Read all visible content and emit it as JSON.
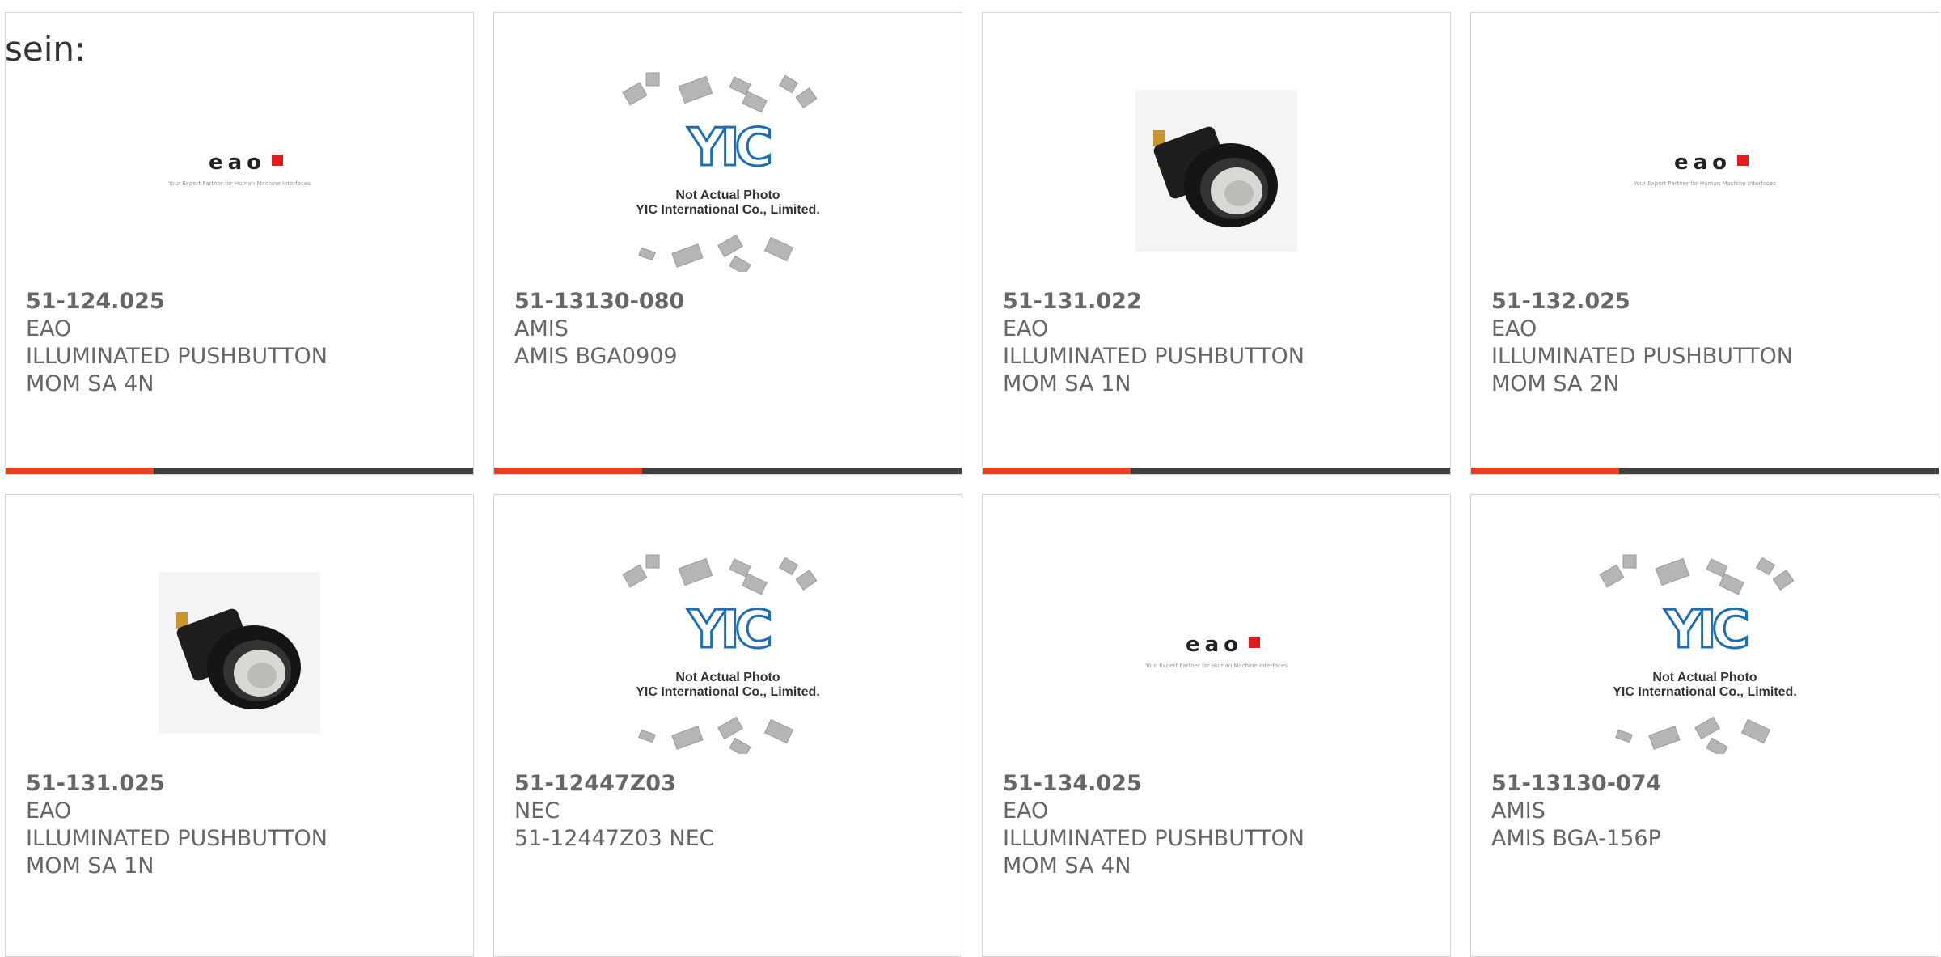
{
  "lead_text": "sein:",
  "colors": {
    "accent": "#e8401c",
    "bar": "#3f3f3f",
    "text": "#666666",
    "eao_red": "#e41b1b"
  },
  "placeholder": {
    "title": "Not Actual Photo",
    "company": "YIC International Co., Limited.",
    "logo_text": "YIC"
  },
  "eao_logo": {
    "name": "eao",
    "tagline": "Your Expert Partner for Human Machine Interfaces"
  },
  "products": [
    {
      "part": "51-124.025",
      "maker": "EAO",
      "desc1": "ILLUMINATED PUSHBUTTON",
      "desc2": "MOM SA 4N",
      "image": "eao-logo"
    },
    {
      "part": "51-13130-080",
      "maker": "AMIS",
      "desc1": "AMIS BGA0909",
      "desc2": "",
      "image": "yic-placeholder"
    },
    {
      "part": "51-131.022",
      "maker": "EAO",
      "desc1": "ILLUMINATED PUSHBUTTON",
      "desc2": "MOM SA 1N",
      "image": "pushbutton-photo"
    },
    {
      "part": "51-132.025",
      "maker": "EAO",
      "desc1": "ILLUMINATED PUSHBUTTON",
      "desc2": "MOM SA 2N",
      "image": "eao-logo"
    },
    {
      "part": "51-131.025",
      "maker": "EAO",
      "desc1": "ILLUMINATED PUSHBUTTON",
      "desc2": "MOM SA 1N",
      "image": "pushbutton-photo"
    },
    {
      "part": "51-12447Z03",
      "maker": "NEC",
      "desc1": "51-12447Z03 NEC",
      "desc2": "",
      "image": "yic-placeholder"
    },
    {
      "part": "51-134.025",
      "maker": "EAO",
      "desc1": "ILLUMINATED PUSHBUTTON",
      "desc2": "MOM SA 4N",
      "image": "eao-logo"
    },
    {
      "part": "51-13130-074",
      "maker": "AMIS",
      "desc1": "AMIS BGA-156P",
      "desc2": "",
      "image": "yic-placeholder"
    }
  ]
}
